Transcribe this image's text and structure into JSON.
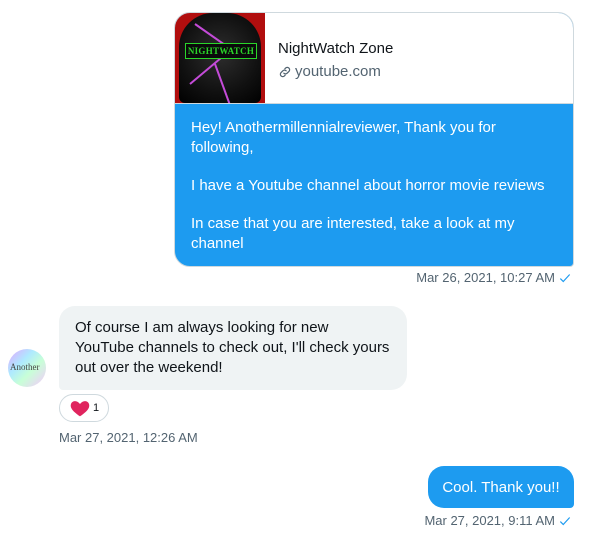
{
  "card_message": {
    "thumbnail_text": "NIGHTWATCH",
    "title": "NightWatch Zone",
    "domain": "youtube.com",
    "paragraphs": [
      "Hey! Anothermillennialreviewer, Thank you for following,",
      "I have a Youtube channel about horror movie reviews",
      "In case that you are interested, take a look at my channel"
    ],
    "timestamp": "Mar 26, 2021, 10:27 AM"
  },
  "incoming_message": {
    "avatar_text": "Another",
    "text": "Of course I am always looking for new YouTube channels to check out, I'll check yours out over the weekend!",
    "reaction": {
      "icon": "heart-icon",
      "count": "1"
    },
    "timestamp": "Mar 27, 2021, 12:26 AM"
  },
  "reply_message": {
    "text": "Cool. Thank you!!",
    "timestamp": "Mar 27, 2021, 9:11 AM"
  },
  "colors": {
    "accent": "#1d9bf0",
    "incoming_bg": "#eff3f4",
    "meta_text": "#536471",
    "heart": "#f91880"
  }
}
